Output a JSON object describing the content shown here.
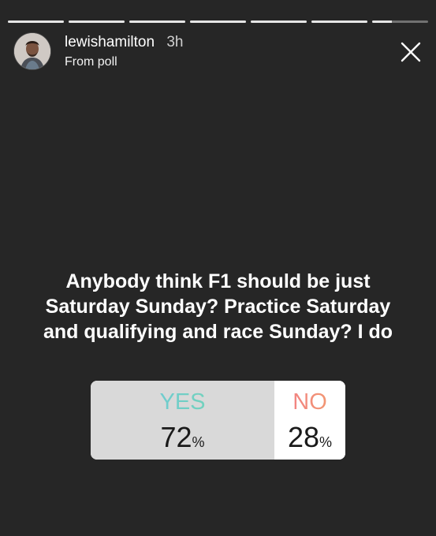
{
  "story": {
    "progress": [
      1,
      1,
      1,
      1,
      1,
      1,
      0.35
    ],
    "colors": {
      "background": "#262626",
      "yes_gradient": [
        "#6ec4e8",
        "#74d9a4"
      ],
      "no_gradient": [
        "#f37a8a",
        "#f1a06a"
      ]
    }
  },
  "header": {
    "username": "lewishamilton",
    "time": "3h",
    "subtitle": "From poll",
    "avatar_icon": "profile-photo",
    "close_icon": "close-icon"
  },
  "question": "Anybody think F1 should be just Saturday Sunday? Practice Saturday and qualifying and race Sunday? I do",
  "poll": {
    "yes": {
      "label": "YES",
      "value": "72",
      "unit": "%"
    },
    "no": {
      "label": "NO",
      "value": "28",
      "unit": "%"
    }
  }
}
